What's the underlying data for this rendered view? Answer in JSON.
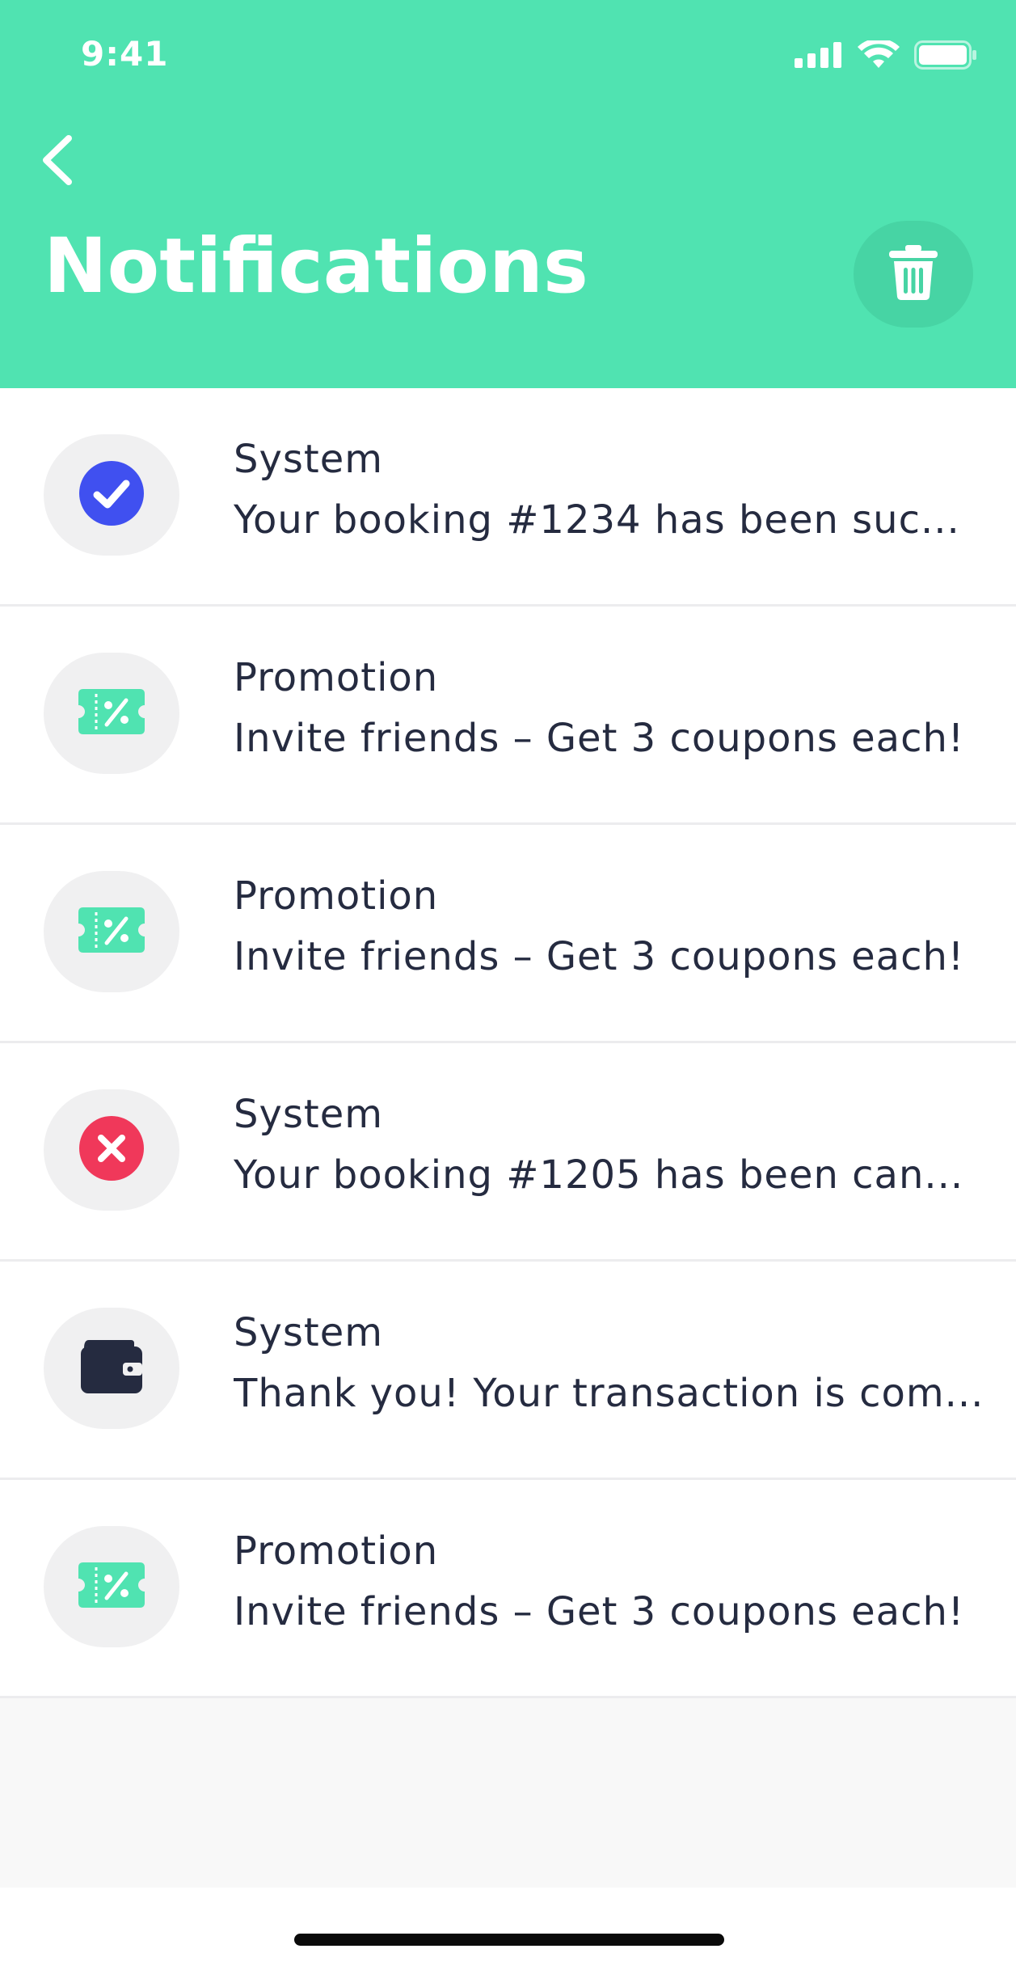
{
  "status_bar": {
    "time": "9:41"
  },
  "header": {
    "title": "Notifications",
    "back_icon": "chevron-left-icon",
    "delete_icon": "trash-icon"
  },
  "colors": {
    "header_bg": "#50e3b1",
    "text_dark": "#252b40",
    "check_blue": "#4050f0",
    "cancel_red": "#f0385a",
    "coupon_green": "#50e3b1",
    "wallet_dark": "#252b40"
  },
  "notifications": [
    {
      "icon": "check-circle-icon",
      "title": "System",
      "message": "Your booking #1234 has been suc..."
    },
    {
      "icon": "coupon-icon",
      "title": "Promotion",
      "message": "Invite friends – Get 3 coupons each!"
    },
    {
      "icon": "coupon-icon",
      "title": "Promotion",
      "message": "Invite friends – Get 3 coupons each!"
    },
    {
      "icon": "x-circle-icon",
      "title": "System",
      "message": "Your booking #1205 has been can..."
    },
    {
      "icon": "wallet-icon",
      "title": "System",
      "message": "Thank you! Your transaction is com..."
    },
    {
      "icon": "coupon-icon",
      "title": "Promotion",
      "message": "Invite friends – Get 3 coupons each!"
    }
  ]
}
